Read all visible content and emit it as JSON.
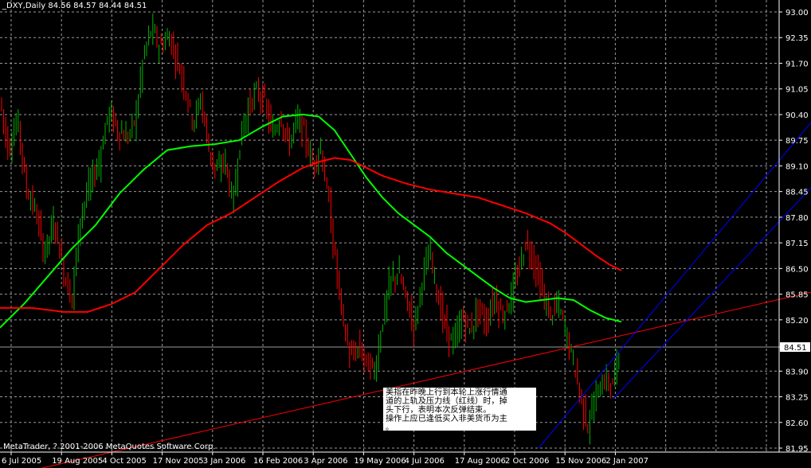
{
  "header": {
    "symbol": "_DXY,Daily",
    "ohlc": "84.56 84.57 84.44 84.51"
  },
  "copyright": "MetaTrader, ? 2001-2006 MetaQuotes Software Corp.",
  "note": {
    "lines": [
      "美指在昨晚上行到本轮上涨行情通",
      "道的上轨及压力线（红线）时，掉",
      "头下行，表明本次反弹结束。",
      "操作上应已逢低买入非美货币为主",
      "。"
    ]
  },
  "colors": {
    "background": "#000000",
    "grid": "#9a9a9a",
    "bull_candle": "#00b200",
    "bear_candle": "#ff0000",
    "ma_fast": "#00ff00",
    "ma_slow": "#ff0000",
    "trendline": "#ff0000",
    "channel": "#0000ff",
    "price_marker_bg": "#ffffff"
  },
  "chart_data": {
    "type": "candlestick",
    "instrument": "_DXY",
    "timeframe": "Daily",
    "last_price": 84.51,
    "ylim": [
      81.95,
      93.0
    ],
    "y_ticks": [
      93.0,
      92.35,
      91.7,
      91.05,
      90.4,
      89.75,
      89.1,
      88.45,
      87.8,
      87.15,
      86.5,
      85.85,
      85.2,
      84.51,
      83.9,
      83.25,
      82.6,
      81.95
    ],
    "x_ticks": [
      "6 Jul 2005",
      "19 Aug 2005",
      "4 Oct 2005",
      "17 Nov 2005",
      "3 Jan 2006",
      "16 Feb 2006",
      "3 Apr 2006",
      "19 May 2006",
      "4 Jul 2006",
      "17 Aug 2006",
      "2 Oct 2006",
      "15 Nov 2006",
      "2 Jan 2007"
    ],
    "grid": true,
    "price_path": [
      [
        0,
        90.8
      ],
      [
        10,
        89.5
      ],
      [
        22,
        90.3
      ],
      [
        32,
        88.6
      ],
      [
        45,
        87.9
      ],
      [
        55,
        86.9
      ],
      [
        68,
        87.7
      ],
      [
        80,
        86.4
      ],
      [
        90,
        85.7
      ],
      [
        100,
        87.8
      ],
      [
        112,
        88.6
      ],
      [
        124,
        89.2
      ],
      [
        136,
        90.5
      ],
      [
        148,
        90.0
      ],
      [
        160,
        89.8
      ],
      [
        170,
        90.3
      ],
      [
        180,
        91.9
      ],
      [
        190,
        92.6
      ],
      [
        200,
        92.1
      ],
      [
        212,
        92.4
      ],
      [
        220,
        91.9
      ],
      [
        232,
        91.1
      ],
      [
        242,
        90.2
      ],
      [
        252,
        90.8
      ],
      [
        262,
        89.5
      ],
      [
        272,
        88.9
      ],
      [
        282,
        89.3
      ],
      [
        292,
        88.1
      ],
      [
        302,
        89.9
      ],
      [
        312,
        90.6
      ],
      [
        322,
        91.0
      ],
      [
        332,
        90.7
      ],
      [
        342,
        89.9
      ],
      [
        352,
        90.4
      ],
      [
        362,
        89.6
      ],
      [
        372,
        90.3
      ],
      [
        382,
        89.9
      ],
      [
        392,
        89.1
      ],
      [
        402,
        89.6
      ],
      [
        412,
        88.2
      ],
      [
        420,
        86.8
      ],
      [
        430,
        85.2
      ],
      [
        440,
        84.2
      ],
      [
        450,
        84.5
      ],
      [
        460,
        84.1
      ],
      [
        470,
        83.9
      ],
      [
        480,
        85.2
      ],
      [
        490,
        86.2
      ],
      [
        500,
        86.4
      ],
      [
        510,
        85.7
      ],
      [
        520,
        85.0
      ],
      [
        530,
        86.3
      ],
      [
        540,
        86.9
      ],
      [
        550,
        85.7
      ],
      [
        560,
        84.9
      ],
      [
        570,
        84.6
      ],
      [
        580,
        85.3
      ],
      [
        590,
        84.9
      ],
      [
        600,
        85.5
      ],
      [
        610,
        85.1
      ],
      [
        620,
        85.8
      ],
      [
        630,
        85.3
      ],
      [
        640,
        85.7
      ],
      [
        650,
        86.4
      ],
      [
        660,
        87.2
      ],
      [
        670,
        86.7
      ],
      [
        680,
        85.9
      ],
      [
        690,
        85.3
      ],
      [
        700,
        85.6
      ],
      [
        710,
        84.9
      ],
      [
        720,
        84.1
      ],
      [
        730,
        83.1
      ],
      [
        738,
        82.5
      ],
      [
        748,
        83.3
      ],
      [
        758,
        83.7
      ],
      [
        768,
        83.5
      ],
      [
        778,
        84.51
      ]
    ],
    "series": [
      {
        "name": "",
        "color": "#00ff00",
        "points": [
          [
            0,
            85.0
          ],
          [
            30,
            85.6
          ],
          [
            60,
            86.3
          ],
          [
            90,
            87.0
          ],
          [
            120,
            87.6
          ],
          [
            150,
            88.4
          ],
          [
            180,
            89.0
          ],
          [
            210,
            89.5
          ],
          [
            240,
            89.6
          ],
          [
            270,
            89.65
          ],
          [
            300,
            89.75
          ],
          [
            330,
            90.1
          ],
          [
            355,
            90.35
          ],
          [
            380,
            90.4
          ],
          [
            400,
            90.35
          ],
          [
            420,
            90.0
          ],
          [
            440,
            89.4
          ],
          [
            460,
            88.8
          ],
          [
            480,
            88.3
          ],
          [
            500,
            87.9
          ],
          [
            520,
            87.6
          ],
          [
            540,
            87.3
          ],
          [
            560,
            86.9
          ],
          [
            580,
            86.6
          ],
          [
            600,
            86.3
          ],
          [
            620,
            86.0
          ],
          [
            640,
            85.75
          ],
          [
            660,
            85.65
          ],
          [
            680,
            85.7
          ],
          [
            700,
            85.75
          ],
          [
            720,
            85.7
          ],
          [
            740,
            85.45
          ],
          [
            760,
            85.25
          ],
          [
            780,
            85.15
          ]
        ]
      },
      {
        "name": "",
        "color": "#ff0000",
        "points": [
          [
            0,
            85.5
          ],
          [
            40,
            85.5
          ],
          [
            80,
            85.4
          ],
          [
            110,
            85.4
          ],
          [
            140,
            85.6
          ],
          [
            170,
            85.9
          ],
          [
            200,
            86.5
          ],
          [
            230,
            87.1
          ],
          [
            260,
            87.6
          ],
          [
            290,
            87.9
          ],
          [
            320,
            88.3
          ],
          [
            350,
            88.7
          ],
          [
            380,
            89.05
          ],
          [
            400,
            89.2
          ],
          [
            420,
            89.3
          ],
          [
            440,
            89.25
          ],
          [
            460,
            89.05
          ],
          [
            480,
            88.85
          ],
          [
            510,
            88.65
          ],
          [
            540,
            88.5
          ],
          [
            570,
            88.4
          ],
          [
            600,
            88.3
          ],
          [
            630,
            88.1
          ],
          [
            660,
            87.9
          ],
          [
            690,
            87.65
          ],
          [
            710,
            87.4
          ],
          [
            730,
            87.1
          ],
          [
            750,
            86.8
          ],
          [
            765,
            86.6
          ],
          [
            780,
            86.45
          ]
        ]
      }
    ],
    "trendline": {
      "from": [
        0,
        81.2
      ],
      "to": [
        1018,
        85.9
      ]
    },
    "channel_lines": [
      {
        "from": [
          676,
          81.95
        ],
        "to": [
          1018,
          90.2
        ]
      },
      {
        "from": [
          770,
          83.2
        ],
        "to": [
          1018,
          88.55
        ]
      }
    ]
  }
}
